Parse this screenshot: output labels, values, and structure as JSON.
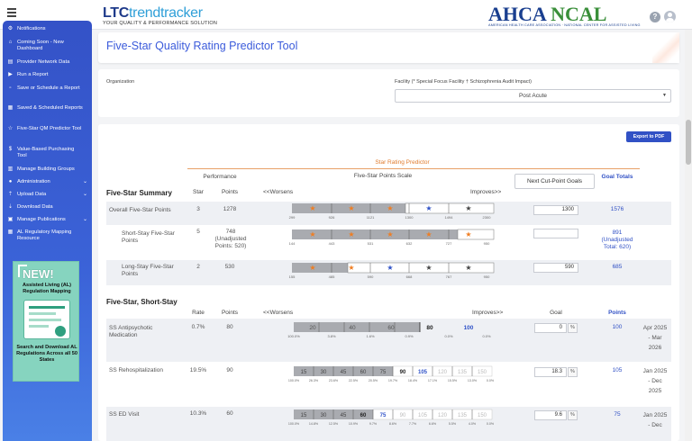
{
  "app": {
    "logo_ltc": "LTC",
    "logo_trend": "trendtracker",
    "logo_tagline": "YOUR QUALITY & PERFORMANCE SOLUTION",
    "brand_ahca": "AHCA",
    "brand_ncal": "NCAL",
    "brand_sub": "AMERICAN HEALTH CARE ASSOCIATION · NATIONAL CENTER FOR ASSISTED LIVING",
    "help": "?"
  },
  "sidebar": {
    "items": [
      {
        "label": "Notifications",
        "icon": "bell-icon"
      },
      {
        "label": "Coming Soon - New Dashboard",
        "icon": "home-icon"
      },
      {
        "label": "Provider Network Data",
        "icon": "chart-icon"
      },
      {
        "label": "Run a Report",
        "icon": "play-icon"
      },
      {
        "label": "Save or Schedule a Report",
        "icon": "calendar-icon"
      },
      {
        "label": "Saved & Scheduled Reports",
        "icon": "grid-icon"
      },
      {
        "label": "Five-Star QM Predictor Tool",
        "icon": "star-icon"
      },
      {
        "label": "Value-Based Purchasing Tool",
        "icon": "dollar-icon"
      },
      {
        "label": "Manage Building Groups",
        "icon": "building-icon"
      },
      {
        "label": "Administration",
        "icon": "user-icon"
      },
      {
        "label": "Upload Data",
        "icon": "upload-icon"
      },
      {
        "label": "Download Data",
        "icon": "download-icon"
      },
      {
        "label": "Manage Publications",
        "icon": "book-icon"
      },
      {
        "label": "AL Regulatory Mapping Resource",
        "icon": "map-icon"
      }
    ],
    "promo": {
      "new": "NEW!",
      "title": "Assisted Living (AL) Regulation Mapping",
      "body": "Search and Download AL Regulations Across all 50 States"
    }
  },
  "page": {
    "title": "Five-Star Quality Rating Predictor Tool",
    "org_label": "Organization",
    "facility_label": "Facility (* Special Focus Facility † Schizophrenia Audit Impact)",
    "facility_value": "Post Acute",
    "export_button": "Export to PDF",
    "star_rating_predictor": "Star Rating Predictor"
  },
  "summary": {
    "heading": "Five-Star Summary",
    "col_performance": "Performance",
    "col_star": "Star",
    "col_points": "Points",
    "col_scale": "Five-Star Points Scale",
    "worsens": "<<Worsens",
    "improves": "Improves>>",
    "next_button": "Next Cut-Point Goals",
    "col_goal_totals": "Goal Totals",
    "rows": [
      {
        "name": "Overall Five-Star Points",
        "star": "3",
        "points": "1278",
        "scale": [
          "299",
          "926",
          "1121",
          "1300",
          "1494",
          "2300"
        ],
        "goal": "1300",
        "total": "1576"
      },
      {
        "name": "Short-Stay Five-Star Points",
        "star": "5",
        "points": "748",
        "points_note": "(Unadjusted Points: 520)",
        "scale": [
          "144",
          "443",
          "531",
          "632",
          "727",
          "950"
        ],
        "goal": "",
        "total": "891",
        "total_note": "(Unadjusted Total: 620)"
      },
      {
        "name": "Long-Stay Five-Star Points",
        "star": "2",
        "points": "530",
        "scale": [
          "155",
          "485",
          "590",
          "668",
          "767",
          "950"
        ],
        "goal": "590",
        "total": "685"
      }
    ]
  },
  "shortstay": {
    "heading": "Five-Star, Short-Stay",
    "col_rate": "Rate",
    "col_points": "Points",
    "worsens": "<<Worsens",
    "improves": "Improves>>",
    "col_goal": "Goal",
    "col_points2": "Points",
    "pct": "%",
    "rows": [
      {
        "name": "SS Antipsychotic Medication",
        "rate": "0.7%",
        "points": "80",
        "bar": [
          "20",
          "40",
          "60",
          "80",
          "100"
        ],
        "ticks": [
          "100.0%",
          "3.8%",
          "1.6%",
          "0.9%",
          "0.0%",
          "0.0%"
        ],
        "goal": "0",
        "goal_points": "100",
        "period": "Apr 2025 - Mar 2026"
      },
      {
        "name": "SS Rehospitalization",
        "rate": "19.5%",
        "points": "90",
        "bar": [
          "15",
          "30",
          "45",
          "60",
          "75",
          "90",
          "105",
          "120",
          "135",
          "150"
        ],
        "ticks": [
          "100.0%",
          "26.3%",
          "23.6%",
          "22.5%",
          "20.5%",
          "19.7%",
          "18.4%",
          "17.1%",
          "15.5%",
          "13.0%",
          "0.0%"
        ],
        "goal": "18.3",
        "goal_points": "105",
        "period": "Jan 2025 - Dec 2025"
      },
      {
        "name": "SS ED Visit",
        "rate": "10.3%",
        "points": "60",
        "bar": [
          "15",
          "30",
          "45",
          "60",
          "75",
          "90",
          "105",
          "120",
          "135",
          "150"
        ],
        "ticks": [
          "100.0%",
          "14.8%",
          "12.5%",
          "10.9%",
          "9.7%",
          "8.6%",
          "7.7%",
          "6.6%",
          "5.5%",
          "4.0%",
          "0.0%"
        ],
        "goal": "9.6",
        "goal_points": "75",
        "period": "Jan 2025 - Dec"
      }
    ]
  },
  "colors": {
    "primary": "#3151c5",
    "accent": "#e07b2d",
    "star_orange": "#ef7d22",
    "star_blue": "#2f52c8",
    "star_gray": "#444"
  }
}
